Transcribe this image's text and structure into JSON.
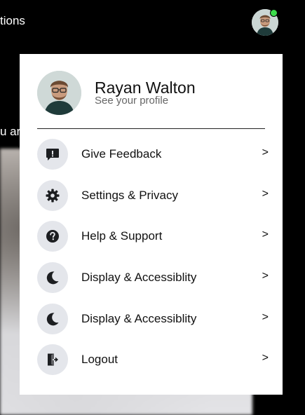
{
  "background": {
    "nav_text": "tions",
    "content_text": "u ar"
  },
  "nav": {
    "avatar_alt": "User avatar",
    "online_color": "#3cdc4b"
  },
  "profile": {
    "name": "Rayan Walton",
    "subtitle": "See your profile"
  },
  "menu_items": [
    {
      "icon": "feedback-icon",
      "label": "Give Feedback",
      "arrow": ">"
    },
    {
      "icon": "gear-icon",
      "label": "Settings & Privacy",
      "arrow": ">"
    },
    {
      "icon": "help-icon",
      "label": "Help & Support",
      "arrow": ">"
    },
    {
      "icon": "moon-icon",
      "label": "Display & Accessiblity",
      "arrow": ">"
    },
    {
      "icon": "moon-icon",
      "label": "Display & Accessiblity",
      "arrow": ">"
    },
    {
      "icon": "logout-icon",
      "label": "Logout",
      "arrow": ">"
    }
  ],
  "colors": {
    "icon_bg": "#e4e6eb",
    "icon_fg": "#1c1e21",
    "panel_bg": "#ffffff",
    "page_bg": "#000000"
  }
}
